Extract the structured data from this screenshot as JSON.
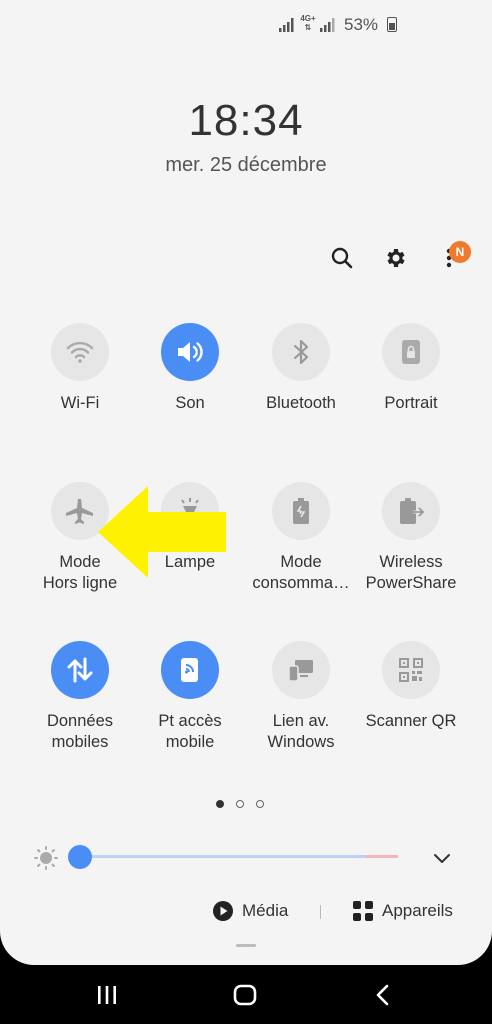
{
  "status_bar": {
    "network_label": "4G+",
    "battery_percent": "53%",
    "battery_level": 0.53
  },
  "clock": {
    "time": "18:34",
    "date": "mer. 25 décembre"
  },
  "header": {
    "search_icon": "search-icon",
    "settings_icon": "gear-icon",
    "more_icon": "more-vertical-icon",
    "notification_badge": "N",
    "badge_color": "#ef7a2b"
  },
  "tiles": [
    {
      "label": "Wi-Fi",
      "icon": "wifi-icon",
      "active": false
    },
    {
      "label": "Son",
      "icon": "volume-icon",
      "active": true
    },
    {
      "label": "Bluetooth",
      "icon": "bluetooth-icon",
      "active": false
    },
    {
      "label": "Portrait",
      "icon": "portrait-lock-icon",
      "active": false
    },
    {
      "label": "Mode\nHors ligne",
      "icon": "airplane-icon",
      "active": false
    },
    {
      "label": "Lampe",
      "icon": "flashlight-icon",
      "active": false
    },
    {
      "label": "Mode\nconsomma…",
      "icon": "battery-saver-icon",
      "active": false
    },
    {
      "label": "Wireless\nPowerShare",
      "icon": "wireless-powershare-icon",
      "active": false
    },
    {
      "label": "Données\nmobiles",
      "icon": "mobile-data-icon",
      "active": true
    },
    {
      "label": "Pt accès\nmobile",
      "icon": "hotspot-icon",
      "active": true
    },
    {
      "label": "Lien av.\nWindows",
      "icon": "link-windows-icon",
      "active": false
    },
    {
      "label": "Scanner QR",
      "icon": "qr-scanner-icon",
      "active": false
    }
  ],
  "pager": {
    "pages": 3,
    "current": 1
  },
  "brightness": {
    "icon": "sun-icon",
    "level": 0.0,
    "expand_icon": "chevron-down-icon"
  },
  "footer": {
    "media_label": "Média",
    "devices_label": "Appareils"
  },
  "navbar": {
    "recents_icon": "recents-icon",
    "home_icon": "home-icon",
    "back_icon": "back-icon"
  },
  "annotation": {
    "color": "#fff200"
  },
  "colors": {
    "accent": "#4a8ef5",
    "panel": "#f4f4f4",
    "tile_off": "#e6e6e6"
  }
}
